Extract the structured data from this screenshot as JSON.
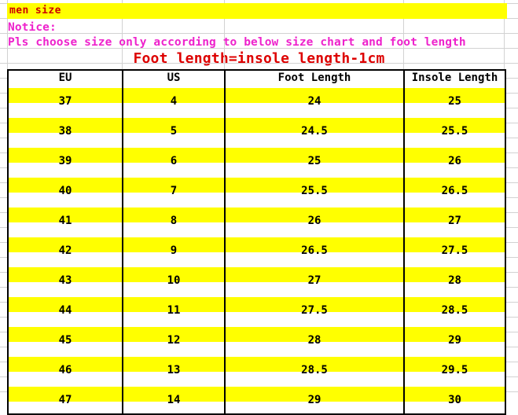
{
  "banner": {
    "title": "men size"
  },
  "notice": {
    "label": "Notice:",
    "text": "Pls choose size only according to below size chart and foot length",
    "formula": "Foot length=insole length-1cm"
  },
  "colors": {
    "banner_bg": "#ffff00",
    "banner_text": "#cc0000",
    "notice_text": "#ee22cc",
    "formula_text": "#dd0000",
    "row_highlight": "#ffff00",
    "grid": "#000000",
    "sheet_grid": "#d2d2d2"
  },
  "chart_data": {
    "type": "table",
    "title": "men size",
    "columns": [
      "EU",
      "US",
      "Foot Length",
      "Insole Length"
    ],
    "rows": [
      [
        "37",
        "4",
        "24",
        "25"
      ],
      [
        "38",
        "5",
        "24.5",
        "25.5"
      ],
      [
        "39",
        "6",
        "25",
        "26"
      ],
      [
        "40",
        "7",
        "25.5",
        "26.5"
      ],
      [
        "41",
        "8",
        "26",
        "27"
      ],
      [
        "42",
        "9",
        "26.5",
        "27.5"
      ],
      [
        "43",
        "10",
        "27",
        "28"
      ],
      [
        "44",
        "11",
        "27.5",
        "28.5"
      ],
      [
        "45",
        "12",
        "28",
        "29"
      ],
      [
        "46",
        "13",
        "28.5",
        "29.5"
      ],
      [
        "47",
        "14",
        "29",
        "30"
      ]
    ]
  }
}
